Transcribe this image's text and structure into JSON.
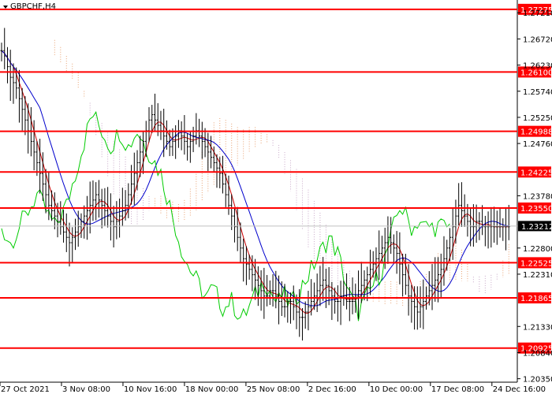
{
  "chart_data": {
    "type": "candlestick",
    "title": "GBPCHF,H4",
    "y_axis_ticks": [
      "1.27210",
      "1.26720",
      "1.26230",
      "1.25740",
      "1.25250",
      "1.24760",
      "1.23780",
      "1.22800",
      "1.22310",
      "1.21330",
      "1.20840",
      "1.20350"
    ],
    "x_axis_labels": [
      "27 Oct 2021",
      "3 Nov 08:00",
      "10 Nov 16:00",
      "18 Nov 00:00",
      "25 Nov 08:00",
      "2 Dec 16:00",
      "10 Dec 00:00",
      "17 Dec 08:00",
      "24 Dec 16:00"
    ],
    "ylim": [
      1.203,
      1.2745
    ],
    "current_price": "1.23212",
    "horizontal_levels": [
      "1.27275",
      "1.26100",
      "1.24988",
      "1.24225",
      "1.23550",
      "1.22525",
      "1.21865",
      "1.20925"
    ],
    "series": [
      {
        "kind": "price_bars",
        "x": [
          1,
          2,
          3,
          4,
          5,
          6,
          7,
          8,
          9,
          10,
          11,
          12,
          13,
          14,
          15,
          16,
          17,
          18,
          19,
          20,
          21,
          22,
          23,
          24,
          25,
          26,
          27,
          28,
          29,
          30,
          31,
          32,
          33,
          34,
          35,
          36,
          37,
          38,
          39,
          40,
          41,
          42,
          43,
          44,
          45,
          46,
          47,
          48,
          49,
          50,
          51,
          52,
          53,
          54,
          55,
          56,
          57,
          58,
          59,
          60,
          61,
          62,
          63,
          64,
          65,
          66,
          67,
          68,
          69,
          70,
          71,
          72,
          73,
          74,
          75,
          76,
          77,
          78,
          79,
          80,
          81,
          82,
          83,
          84,
          85,
          86,
          87,
          88,
          89,
          90,
          91,
          92,
          93,
          94,
          95,
          96,
          97,
          98,
          99,
          100,
          101,
          102,
          103,
          104,
          105,
          106,
          107,
          108,
          109,
          110,
          111,
          112,
          113,
          114,
          115,
          116,
          117,
          118,
          119,
          120,
          121,
          122,
          123,
          124,
          125,
          126,
          127,
          128,
          129,
          130,
          131,
          132,
          133,
          134,
          135,
          136,
          137,
          138,
          139,
          140,
          141,
          142,
          143,
          144,
          145,
          146,
          147,
          148,
          149,
          150,
          151,
          152,
          153,
          154,
          155,
          156,
          157,
          158,
          159,
          160,
          161,
          162,
          163,
          164,
          165,
          166,
          167,
          168,
          169,
          170,
          171,
          172,
          173,
          174,
          175
        ],
        "close": [
          1.265,
          1.264,
          1.262,
          1.26,
          1.259,
          1.258,
          1.256,
          1.254,
          1.252,
          1.25,
          1.248,
          1.246,
          1.244,
          1.242,
          1.24,
          1.238,
          1.236,
          1.235,
          1.234,
          1.233,
          1.232,
          1.231,
          1.23,
          1.229,
          1.23,
          1.231,
          1.232,
          1.233,
          1.234,
          1.235,
          1.236,
          1.237,
          1.238,
          1.237,
          1.236,
          1.235,
          1.234,
          1.233,
          1.232,
          1.233,
          1.234,
          1.235,
          1.236,
          1.238,
          1.24,
          1.242,
          1.244,
          1.246,
          1.248,
          1.25,
          1.252,
          1.253,
          1.252,
          1.251,
          1.25,
          1.249,
          1.248,
          1.247,
          1.248,
          1.249,
          1.25,
          1.249,
          1.248,
          1.247,
          1.248,
          1.249,
          1.25,
          1.249,
          1.248,
          1.247,
          1.246,
          1.245,
          1.244,
          1.243,
          1.242,
          1.24,
          1.238,
          1.236,
          1.234,
          1.232,
          1.23,
          1.228,
          1.226,
          1.225,
          1.224,
          1.223,
          1.222,
          1.221,
          1.22,
          1.219,
          1.219,
          1.22,
          1.22,
          1.219,
          1.218,
          1.217,
          1.217,
          1.218,
          1.218,
          1.217,
          1.216,
          1.215,
          1.215,
          1.216,
          1.217,
          1.218,
          1.219,
          1.22,
          1.221,
          1.222,
          1.221,
          1.22,
          1.219,
          1.218,
          1.218,
          1.219,
          1.219,
          1.218,
          1.218,
          1.218,
          1.219,
          1.22,
          1.221,
          1.222,
          1.223,
          1.224,
          1.225,
          1.226,
          1.227,
          1.228,
          1.229,
          1.23,
          1.229,
          1.228,
          1.227,
          1.225,
          1.223,
          1.221,
          1.219,
          1.218,
          1.217,
          1.216,
          1.217,
          1.218,
          1.219,
          1.22,
          1.221,
          1.222,
          1.223,
          1.224,
          1.226,
          1.228,
          1.23,
          1.232,
          1.234,
          1.236,
          1.235,
          1.234,
          1.233,
          1.232,
          1.232,
          1.233,
          1.233,
          1.232,
          1.232,
          1.232,
          1.232,
          1.232,
          1.232,
          1.232,
          1.232,
          1.232,
          1.232
        ]
      }
    ],
    "legend": "none",
    "grid": false
  },
  "colors": {
    "level_line": "#ff0000",
    "level_label_bg": "#ff0000",
    "price_bar": "#000000",
    "kijun": "#0000cc",
    "tenkan": "#cc0000",
    "chikou": "#00cc00",
    "cloud_orange": "#e8a070",
    "cloud_lilac": "#c8a8c8"
  }
}
